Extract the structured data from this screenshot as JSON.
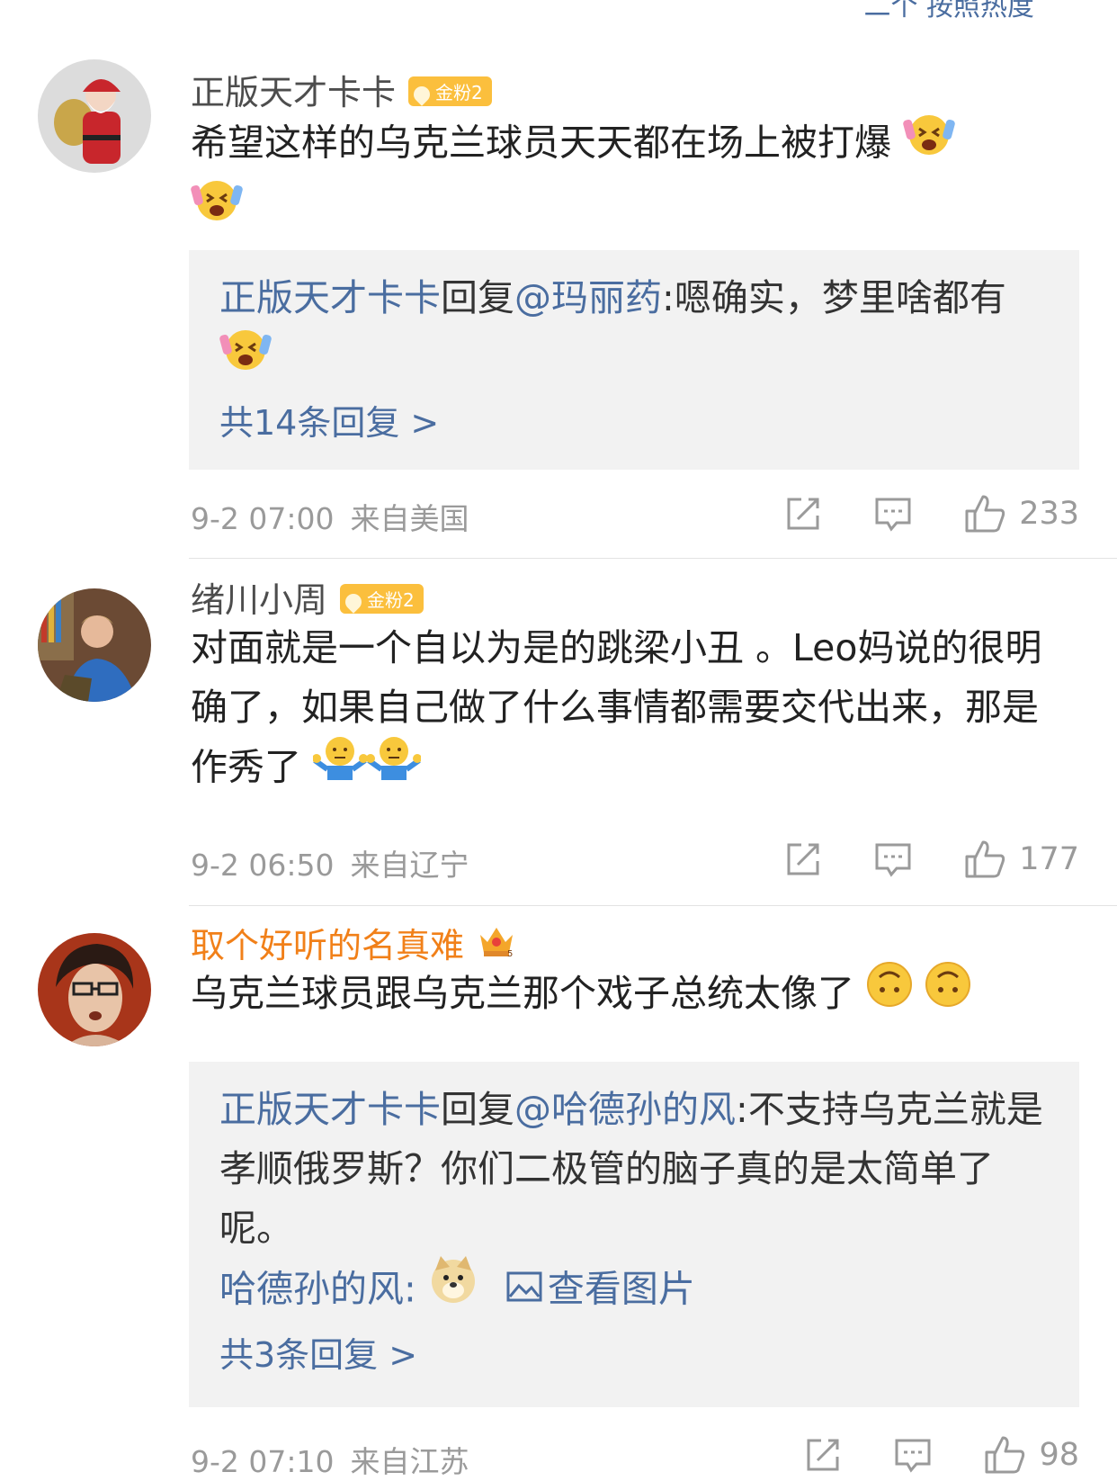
{
  "top_partial": "二个 按照热度",
  "comments": [
    {
      "username": "正版天才卡卡",
      "badge": "金粉2",
      "text": "希望这样的乌克兰球员天天都在场上被打爆",
      "reply": {
        "author": "正版天才卡卡",
        "reply_word": "回复",
        "mention": "@玛丽药",
        "body": ":嗯确实，梦里啥都有",
        "count": "共14条回复 >"
      },
      "time": "9-2 07:00",
      "location": "来自美国",
      "likes": "233"
    },
    {
      "username": "绪川小周",
      "badge": "金粉2",
      "text": "对面就是一个自以为是的跳梁小丑 。Leo妈说的很明确了，如果自己做了什么事情都需要交代出来，那是作秀了",
      "time": "9-2 06:50",
      "location": "来自辽宁",
      "likes": "177"
    },
    {
      "username": "取个好听的名真难",
      "text": "乌克兰球员跟乌克兰那个戏子总统太像了",
      "reply": {
        "author": "正版天才卡卡",
        "reply_word": "回复",
        "mention": "@哈德孙的风",
        "body": ":不支持乌克兰就是孝顺俄罗斯？你们二极管的脑子真的是太简单了呢。",
        "second_author": "哈德孙的风:",
        "view_image": "查看图片",
        "count": "共3条回复 >"
      },
      "time": "9-2 07:10",
      "location": "来自江苏",
      "likes": "98"
    }
  ],
  "icons": [
    "santa-avatar",
    "man-avatar",
    "anime-avatar",
    "laugh-cry-emoji",
    "shrug-emoji",
    "upside-down-emoji",
    "doge-emoji",
    "repost-icon",
    "comment-icon",
    "like-icon",
    "image-icon",
    "crown-icon"
  ]
}
